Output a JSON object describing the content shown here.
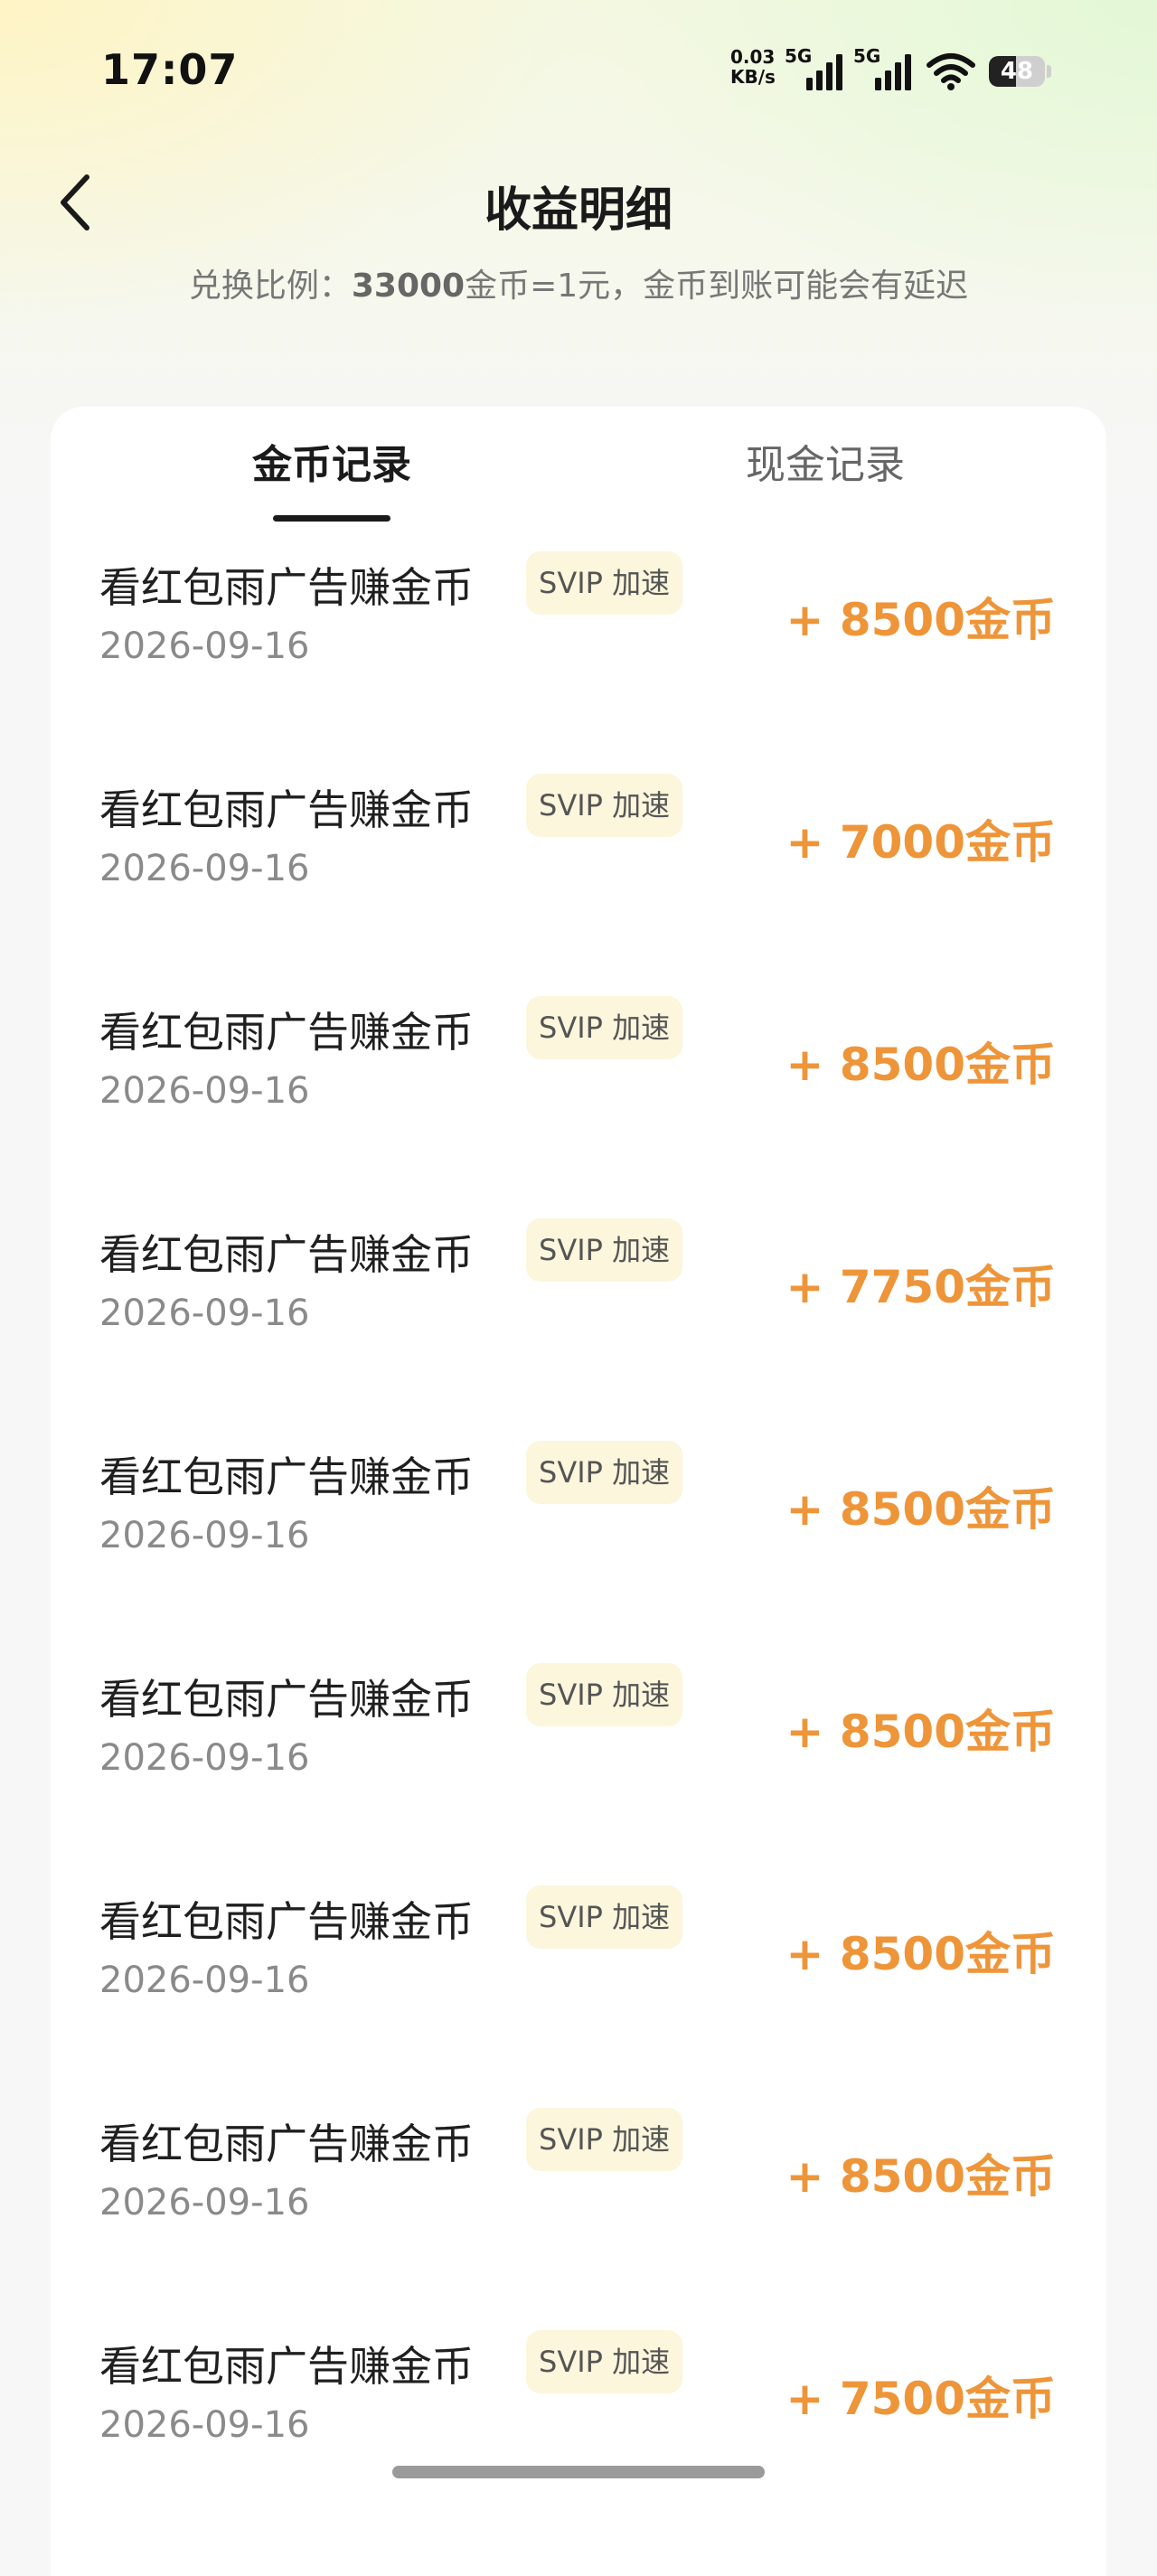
{
  "status_bar": {
    "time": "17:07",
    "net_speed_value": "0.03",
    "net_speed_unit": "KB/s",
    "sim1_label": "5G",
    "sim2_label": "5G",
    "battery_level": "48",
    "battery_fraction": 0.48
  },
  "header": {
    "title": "收益明细",
    "subtitle_prefix": "兑换比例：",
    "subtitle_ratio": "33000",
    "subtitle_suffix": "金币=1元，金币到账可能会有延迟"
  },
  "tabs": [
    {
      "label": "金币记录",
      "active": true
    },
    {
      "label": "现金记录",
      "active": false
    }
  ],
  "records": [
    {
      "title": "看红包雨广告赚金币",
      "badge": "SVIP 加速",
      "date": "2026-09-16",
      "amount": "+ 8500金币"
    },
    {
      "title": "看红包雨广告赚金币",
      "badge": "SVIP 加速",
      "date": "2026-09-16",
      "amount": "+ 7000金币"
    },
    {
      "title": "看红包雨广告赚金币",
      "badge": "SVIP 加速",
      "date": "2026-09-16",
      "amount": "+ 8500金币"
    },
    {
      "title": "看红包雨广告赚金币",
      "badge": "SVIP 加速",
      "date": "2026-09-16",
      "amount": "+ 7750金币"
    },
    {
      "title": "看红包雨广告赚金币",
      "badge": "SVIP 加速",
      "date": "2026-09-16",
      "amount": "+ 8500金币"
    },
    {
      "title": "看红包雨广告赚金币",
      "badge": "SVIP 加速",
      "date": "2026-09-16",
      "amount": "+ 8500金币"
    },
    {
      "title": "看红包雨广告赚金币",
      "badge": "SVIP 加速",
      "date": "2026-09-16",
      "amount": "+ 8500金币"
    },
    {
      "title": "看红包雨广告赚金币",
      "badge": "SVIP 加速",
      "date": "2026-09-16",
      "amount": "+ 8500金币"
    },
    {
      "title": "看红包雨广告赚金币",
      "badge": "SVIP 加速",
      "date": "2026-09-16",
      "amount": "+ 7500金币"
    }
  ],
  "colors": {
    "amount": "#ee9539",
    "badge_bg": "#fbf6dc",
    "active_tab": "#1a1a1a",
    "inactive_tab": "#666666"
  },
  "icons": {
    "back": "chevron-left-icon",
    "signal": "signal-bars-icon",
    "wifi": "wifi-icon",
    "battery": "battery-icon"
  }
}
